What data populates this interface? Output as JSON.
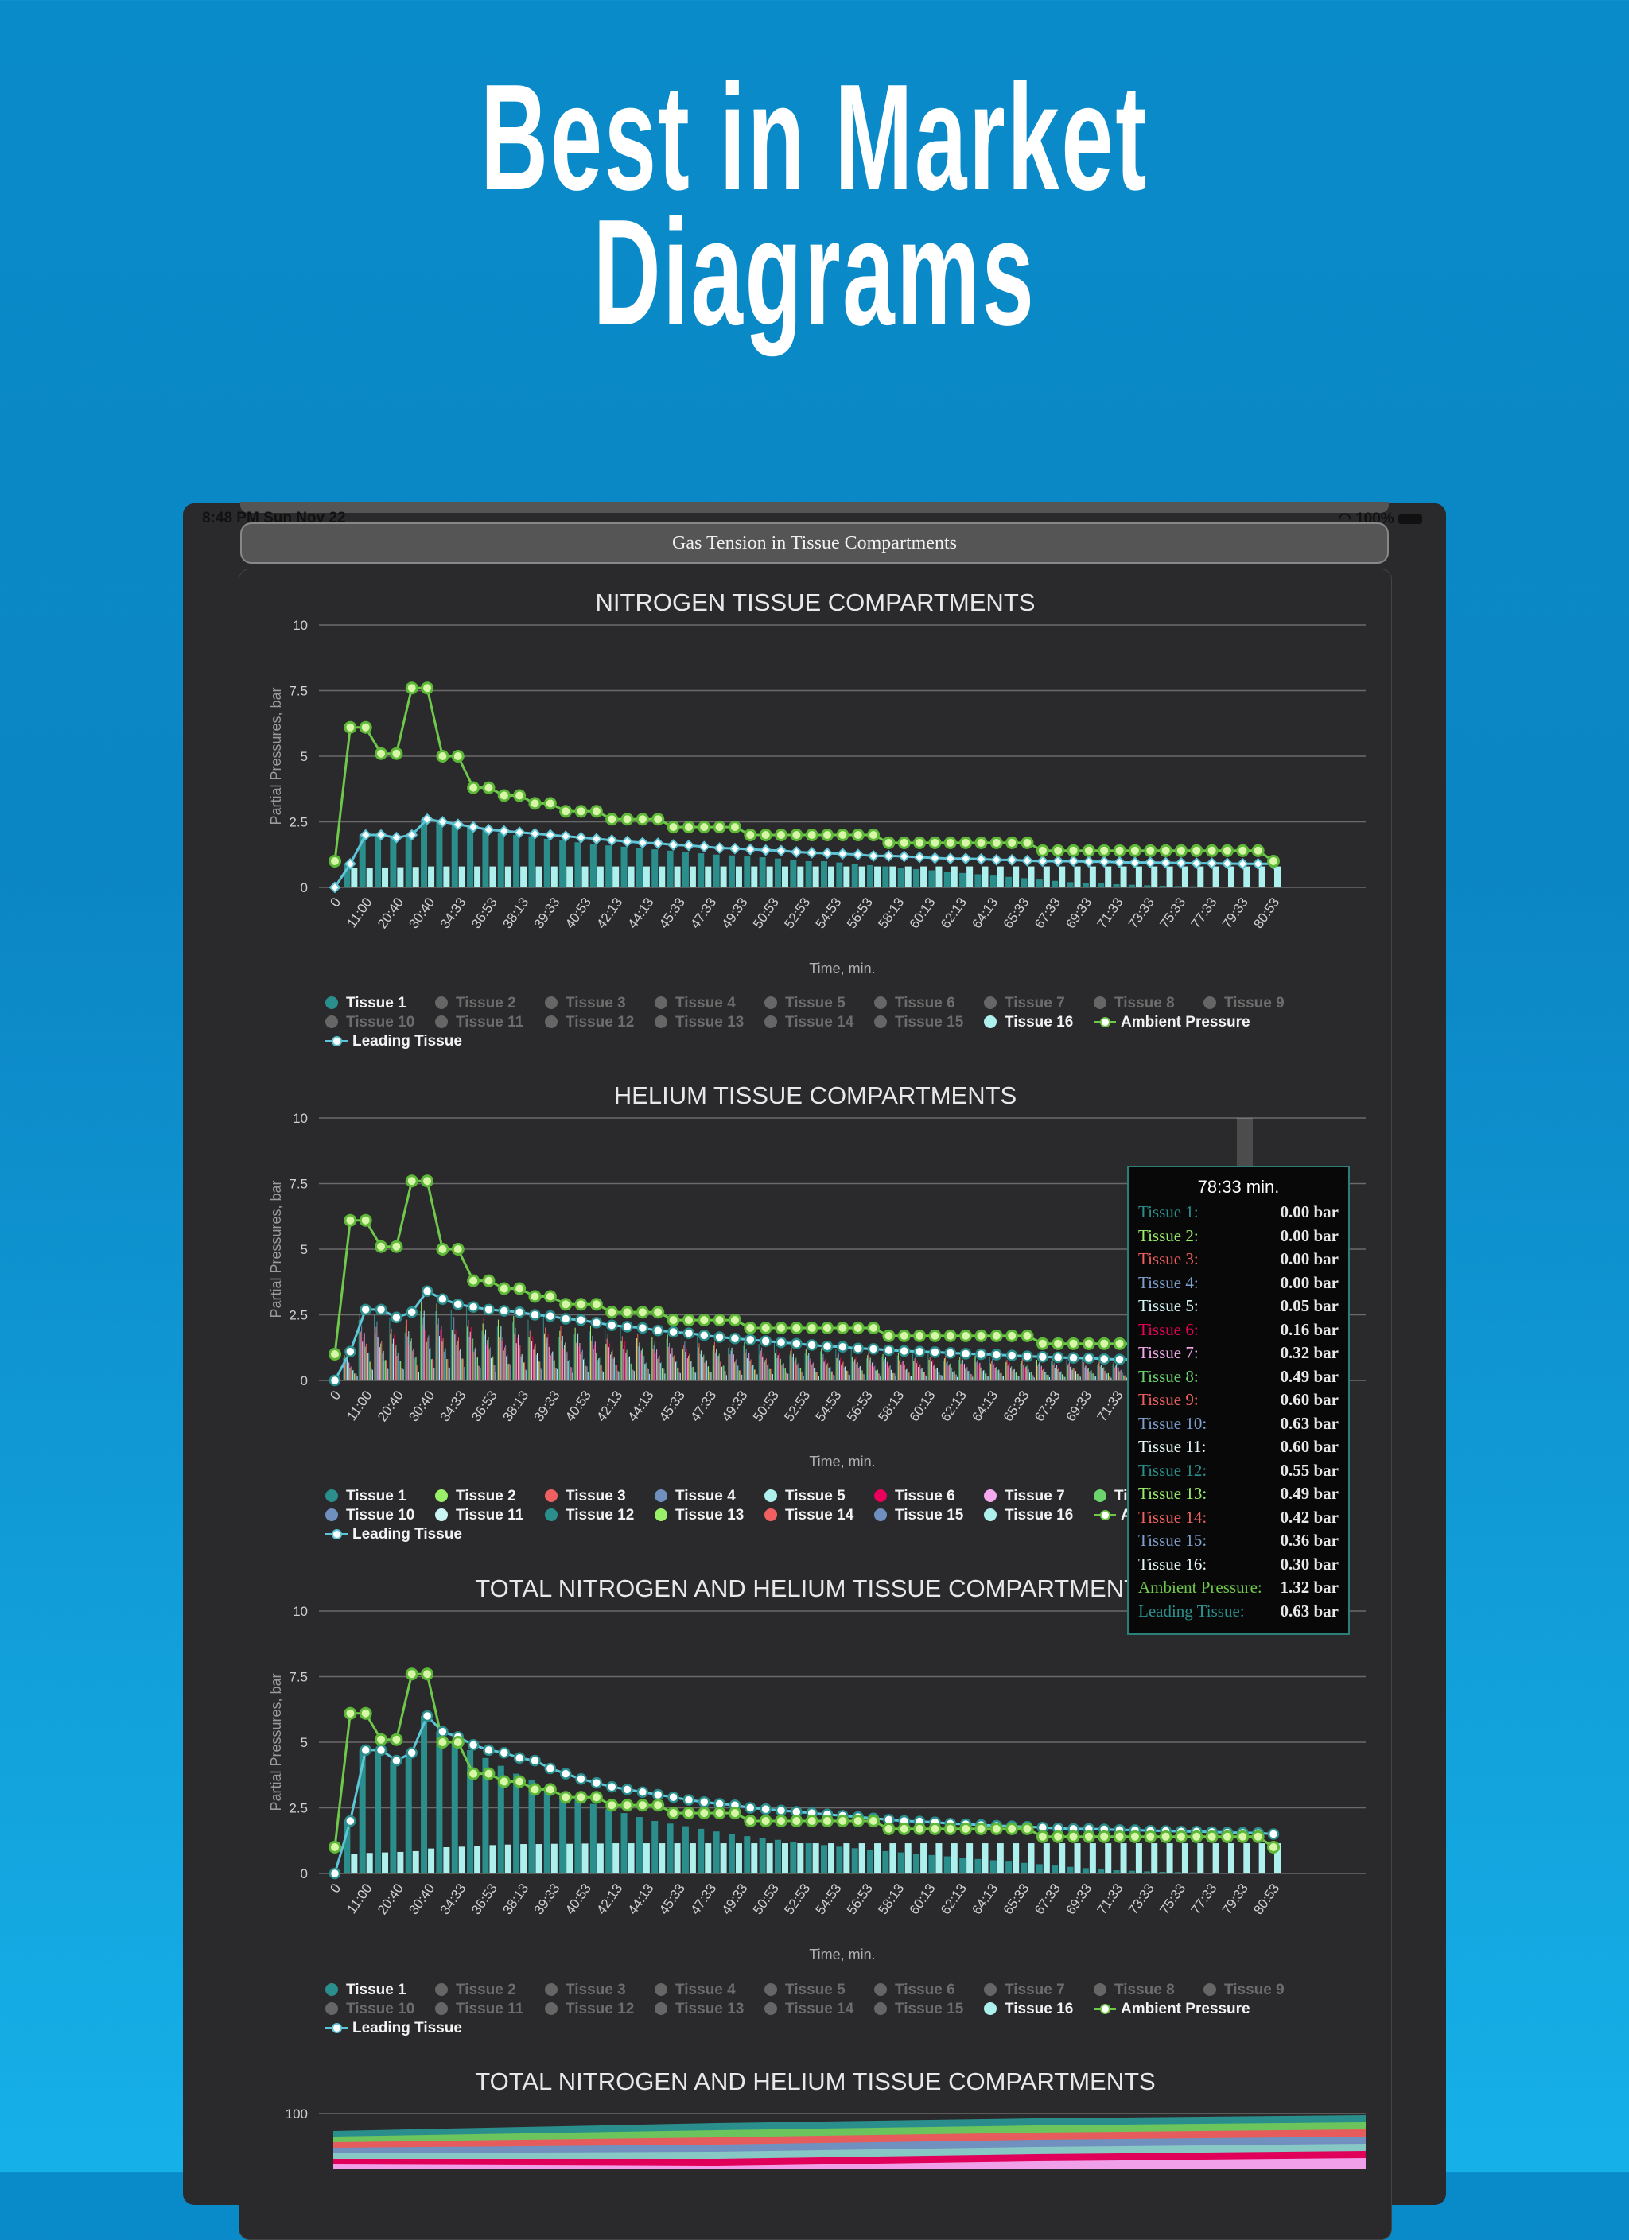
{
  "hero": {
    "line1": "Best in Market",
    "line2": "Diagrams"
  },
  "status": {
    "time": "8:48 PM   Sun Nov 22",
    "battery": "100%"
  },
  "titlebar": {
    "title": "Gas Tension in Tissue Compartments"
  },
  "colors": {
    "teal": "#2a8f8c",
    "cyan": "#aef0ee",
    "green": "#6ccc44",
    "amb_line": "#6fc84a",
    "lead_line": "#5ec5d6",
    "tissue": [
      "#2a8f8c",
      "#9bf06a",
      "#f06060",
      "#6f8fbf",
      "#aef0ee",
      "#e8005a",
      "#f4a8ee",
      "#6cd46c",
      "#f06060",
      "#6f8fbf",
      "#c9f5f5",
      "#2a8f8c",
      "#9bf06a",
      "#f06060",
      "#6f8fbf",
      "#aef0ee"
    ]
  },
  "charts": [
    {
      "title": "NITROGEN TISSUE COMPARTMENTS",
      "xlabel": "Time, min.",
      "ylabel": "Partial Pressures, bar",
      "legend_on": [
        "Tissue 1",
        "Tissue 16",
        "Ambient Pressure",
        "Leading Tissue"
      ],
      "lead_style": "diamond"
    },
    {
      "title": "HELIUM TISSUE COMPARTMENTS",
      "xlabel": "Time, min.",
      "ylabel": "Partial Pressures, bar",
      "legend_on": [
        "Tissue 1",
        "Tissue 2",
        "Tissue 3",
        "Tissue 4",
        "Tissue 5",
        "Tissue 6",
        "Tissue 7",
        "Tissue 8",
        "Tissue 9",
        "Tissue 10",
        "Tissue 11",
        "Tissue 12",
        "Tissue 13",
        "Tissue 14",
        "Tissue 15",
        "Tissue 16",
        "Ambient Pressure",
        "Leading Tissue"
      ],
      "lead_style": "circle"
    },
    {
      "title": "TOTAL NITROGEN AND HELIUM TISSUE COMPARTMENTS",
      "xlabel": "Time, min.",
      "ylabel": "Partial Pressures, bar",
      "legend_on": [
        "Tissue 1",
        "Tissue 16",
        "Ambient Pressure",
        "Leading Tissue"
      ],
      "lead_style": "circle"
    },
    {
      "title": "TOTAL NITROGEN AND HELIUM TISSUE COMPARTMENTS",
      "ytick_top": "100"
    }
  ],
  "legend_labels": {
    "row1": [
      "Tissue 1",
      "Tissue 2",
      "Tissue 3",
      "Tissue 4",
      "Tissue 5",
      "Tissue 6",
      "Tissue 7",
      "Tissue 8",
      "Tissue 9"
    ],
    "row2": [
      "Tissue 10",
      "Tissue 11",
      "Tissue 12",
      "Tissue 13",
      "Tissue 14",
      "Tissue 15",
      "Tissue 16",
      "Ambient Pressure"
    ],
    "row3": [
      "Leading Tissue"
    ]
  },
  "tooltip": {
    "title": "78:33 min.",
    "rows": [
      {
        "name": "Tissue 1:",
        "value": "0.00 bar",
        "color": "#2a8f8c"
      },
      {
        "name": "Tissue 2:",
        "value": "0.00 bar",
        "color": "#9bf06a"
      },
      {
        "name": "Tissue 3:",
        "value": "0.00 bar",
        "color": "#f06060"
      },
      {
        "name": "Tissue 4:",
        "value": "0.00 bar",
        "color": "#7f9fcf"
      },
      {
        "name": "Tissue 5:",
        "value": "0.05 bar",
        "color": "#d4f6f6"
      },
      {
        "name": "Tissue 6:",
        "value": "0.16 bar",
        "color": "#e8005a"
      },
      {
        "name": "Tissue 7:",
        "value": "0.32 bar",
        "color": "#f4a8ee"
      },
      {
        "name": "Tissue 8:",
        "value": "0.49 bar",
        "color": "#6cd46c"
      },
      {
        "name": "Tissue 9:",
        "value": "0.60 bar",
        "color": "#f06060"
      },
      {
        "name": "Tissue 10:",
        "value": "0.63 bar",
        "color": "#7f9fcf"
      },
      {
        "name": "Tissue 11:",
        "value": "0.60 bar",
        "color": "#e6f8f8"
      },
      {
        "name": "Tissue 12:",
        "value": "0.55 bar",
        "color": "#2a8f8c"
      },
      {
        "name": "Tissue 13:",
        "value": "0.49 bar",
        "color": "#9bf06a"
      },
      {
        "name": "Tissue 14:",
        "value": "0.42 bar",
        "color": "#f06060"
      },
      {
        "name": "Tissue 15:",
        "value": "0.36 bar",
        "color": "#7f9fcf"
      },
      {
        "name": "Tissue 16:",
        "value": "0.30 bar",
        "color": "#e6f8f8"
      },
      {
        "name": "Ambient Pressure:",
        "value": "1.32 bar",
        "color": "#6fc84a"
      },
      {
        "name": "Leading Tissue:",
        "value": "0.63 bar",
        "color": "#2a8f8c"
      }
    ]
  },
  "chart_data": [
    {
      "type": "line",
      "title": "NITROGEN TISSUE COMPARTMENTS",
      "xlabel": "Time, min.",
      "ylabel": "Partial Pressures, bar",
      "ylim": [
        0,
        10
      ],
      "yticks": [
        "0",
        "2.5",
        "5",
        "7.5",
        "10"
      ],
      "x_tick_labels": [
        "0",
        "11:00",
        "20:40",
        "30:40",
        "34:33",
        "36:53",
        "38:13",
        "39:33",
        "40:53",
        "42:13",
        "44:13",
        "45:33",
        "47:33",
        "49:33",
        "50:53",
        "52:53",
        "54:53",
        "56:53",
        "58:13",
        "60:13",
        "62:13",
        "64:13",
        "65:33",
        "67:33",
        "69:33",
        "71:33",
        "73:33",
        "75:33",
        "77:33",
        "79:33",
        "80:53"
      ],
      "series": [
        {
          "name": "Ambient Pressure",
          "values": [
            1.0,
            6.1,
            6.1,
            5.1,
            5.1,
            7.6,
            7.6,
            5.0,
            5.0,
            3.8,
            3.8,
            3.5,
            3.5,
            3.2,
            3.2,
            2.9,
            2.9,
            2.9,
            2.6,
            2.6,
            2.6,
            2.6,
            2.3,
            2.3,
            2.3,
            2.3,
            2.3,
            2.0,
            2.0,
            2.0,
            2.0,
            2.0,
            2.0,
            2.0,
            2.0,
            2.0,
            1.7,
            1.7,
            1.7,
            1.7,
            1.7,
            1.7,
            1.7,
            1.7,
            1.7,
            1.7,
            1.4,
            1.4,
            1.4,
            1.4,
            1.4,
            1.4,
            1.4,
            1.4,
            1.4,
            1.4,
            1.4,
            1.4,
            1.4,
            1.4,
            1.4,
            1.0
          ]
        },
        {
          "name": "Leading Tissue",
          "values": [
            0,
            0.9,
            2.0,
            2.0,
            1.9,
            2.0,
            2.6,
            2.5,
            2.4,
            2.3,
            2.2,
            2.15,
            2.1,
            2.05,
            2.0,
            1.95,
            1.9,
            1.85,
            1.8,
            1.75,
            1.7,
            1.68,
            1.62,
            1.6,
            1.55,
            1.5,
            1.48,
            1.45,
            1.42,
            1.4,
            1.35,
            1.32,
            1.3,
            1.28,
            1.25,
            1.2,
            1.2,
            1.18,
            1.15,
            1.12,
            1.1,
            1.1,
            1.08,
            1.05,
            1.05,
            1.02,
            1.0,
            1.0,
            1.0,
            0.98,
            0.98,
            0.96,
            0.95,
            0.95,
            0.94,
            0.93,
            0.92,
            0.92,
            0.91,
            0.9,
            0.9,
            0.9
          ]
        },
        {
          "name": "Tissue 1",
          "values": [
            0,
            0.9,
            2.0,
            2.0,
            1.9,
            2.0,
            2.6,
            2.5,
            2.4,
            2.3,
            2.2,
            2.1,
            2.0,
            1.95,
            1.85,
            1.8,
            1.72,
            1.65,
            1.6,
            1.55,
            1.5,
            1.45,
            1.4,
            1.35,
            1.3,
            1.25,
            1.22,
            1.18,
            1.15,
            1.1,
            1.05,
            1.0,
            1.0,
            0.95,
            0.9,
            0.85,
            0.8,
            0.75,
            0.7,
            0.65,
            0.6,
            0.55,
            0.5,
            0.45,
            0.4,
            0.35,
            0.3,
            0.25,
            0.2,
            0.18,
            0.15,
            0.12,
            0.1,
            0.08,
            0.06,
            0.05,
            0.04,
            0.03,
            0.02,
            0.01,
            0.01,
            0
          ]
        },
        {
          "name": "Tissue 16",
          "values": [
            0,
            0.75,
            0.75,
            0.76,
            0.77,
            0.78,
            0.8,
            0.8,
            0.8,
            0.8,
            0.8,
            0.8,
            0.8,
            0.8,
            0.8,
            0.8,
            0.8,
            0.8,
            0.8,
            0.8,
            0.8,
            0.8,
            0.8,
            0.8,
            0.8,
            0.8,
            0.8,
            0.8,
            0.8,
            0.8,
            0.8,
            0.8,
            0.8,
            0.8,
            0.8,
            0.8,
            0.8,
            0.8,
            0.8,
            0.8,
            0.8,
            0.8,
            0.8,
            0.8,
            0.8,
            0.8,
            0.8,
            0.8,
            0.8,
            0.8,
            0.8,
            0.8,
            0.8,
            0.8,
            0.8,
            0.8,
            0.8,
            0.8,
            0.8,
            0.8,
            0.8,
            0.8
          ]
        }
      ]
    },
    {
      "type": "line",
      "title": "HELIUM TISSUE COMPARTMENTS",
      "xlabel": "Time, min.",
      "ylabel": "Partial Pressures, bar",
      "ylim": [
        0,
        10
      ],
      "yticks": [
        "0",
        "2.5",
        "5",
        "7.5",
        "10"
      ],
      "x_tick_labels": [
        "0",
        "11:00",
        "20:40",
        "30:40",
        "34:33",
        "36:53",
        "38:13",
        "39:33",
        "40:53",
        "42:13",
        "44:13",
        "45:33",
        "47:33",
        "49:33",
        "50:53",
        "52:53",
        "54:53",
        "56:53",
        "58:13",
        "60:13",
        "62:13",
        "64:13",
        "65:33",
        "67:33",
        "69:33",
        "71:33",
        "73:33",
        "75:33",
        "77:33",
        "79:33",
        "80:53"
      ],
      "series": [
        {
          "name": "Ambient Pressure",
          "values": [
            1.0,
            6.1,
            6.1,
            5.1,
            5.1,
            7.6,
            7.6,
            5.0,
            5.0,
            3.8,
            3.8,
            3.5,
            3.5,
            3.2,
            3.2,
            2.9,
            2.9,
            2.9,
            2.6,
            2.6,
            2.6,
            2.6,
            2.3,
            2.3,
            2.3,
            2.3,
            2.3,
            2.0,
            2.0,
            2.0,
            2.0,
            2.0,
            2.0,
            2.0,
            2.0,
            2.0,
            1.7,
            1.7,
            1.7,
            1.7,
            1.7,
            1.7,
            1.7,
            1.7,
            1.7,
            1.7,
            1.4,
            1.4,
            1.4,
            1.4,
            1.4,
            1.4,
            1.4,
            1.4,
            1.4,
            1.4,
            1.4,
            1.4,
            1.4,
            1.4,
            1.4,
            1.0
          ]
        },
        {
          "name": "Leading Tissue",
          "values": [
            0,
            1.1,
            2.7,
            2.7,
            2.4,
            2.6,
            3.4,
            3.1,
            2.9,
            2.8,
            2.7,
            2.65,
            2.6,
            2.5,
            2.45,
            2.35,
            2.3,
            2.2,
            2.1,
            2.05,
            2.0,
            1.9,
            1.85,
            1.8,
            1.72,
            1.65,
            1.6,
            1.55,
            1.5,
            1.45,
            1.4,
            1.35,
            1.3,
            1.28,
            1.22,
            1.2,
            1.15,
            1.12,
            1.1,
            1.08,
            1.05,
            1.02,
            1.0,
            0.98,
            0.95,
            0.92,
            0.9,
            0.88,
            0.86,
            0.85,
            0.82,
            0.8,
            0.8,
            0.78,
            0.76,
            0.75,
            0.72,
            0.7,
            0.68,
            0.66,
            0.64,
            0.63
          ]
        },
        {
          "name": "Tissue 1",
          "values": [
            0,
            1.1,
            2.7,
            2.7,
            2.4,
            2.6,
            3.4,
            3.1,
            2.9,
            2.8,
            2.7,
            2.65,
            2.6,
            2.5,
            2.45,
            2.35,
            2.3,
            2.2,
            2.1,
            2.05,
            2.0,
            1.9,
            1.85,
            1.8,
            1.72,
            1.65,
            1.6,
            1.55,
            1.5,
            1.45,
            1.4,
            1.35,
            1.3,
            1.28,
            1.22,
            1.2,
            1.15,
            1.12,
            1.1,
            1.08,
            1.05,
            1.02,
            1.0,
            0.98,
            0.95,
            0.92,
            0.9,
            0.88,
            0.86,
            0.85,
            0.82,
            0.8,
            0.8,
            0.78,
            0.76,
            0.75,
            0.72,
            0.7,
            0.68,
            0.66,
            0.64,
            0.63
          ]
        }
      ]
    },
    {
      "type": "line",
      "title": "TOTAL NITROGEN AND HELIUM TISSUE COMPARTMENTS",
      "xlabel": "Time, min.",
      "ylabel": "Partial Pressures, bar",
      "ylim": [
        0,
        10
      ],
      "yticks": [
        "0",
        "2.5",
        "5",
        "7.5",
        "10"
      ],
      "x_tick_labels": [
        "0",
        "11:00",
        "20:40",
        "30:40",
        "34:33",
        "36:53",
        "38:13",
        "39:33",
        "40:53",
        "42:13",
        "44:13",
        "45:33",
        "47:33",
        "49:33",
        "50:53",
        "52:53",
        "54:53",
        "56:53",
        "58:13",
        "60:13",
        "62:13",
        "64:13",
        "65:33",
        "67:33",
        "69:33",
        "71:33",
        "73:33",
        "75:33",
        "77:33",
        "79:33",
        "80:53"
      ],
      "series": [
        {
          "name": "Ambient Pressure",
          "values": [
            1.0,
            6.1,
            6.1,
            5.1,
            5.1,
            7.6,
            7.6,
            5.0,
            5.0,
            3.8,
            3.8,
            3.5,
            3.5,
            3.2,
            3.2,
            2.9,
            2.9,
            2.9,
            2.6,
            2.6,
            2.6,
            2.6,
            2.3,
            2.3,
            2.3,
            2.3,
            2.3,
            2.0,
            2.0,
            2.0,
            2.0,
            2.0,
            2.0,
            2.0,
            2.0,
            2.0,
            1.7,
            1.7,
            1.7,
            1.7,
            1.7,
            1.7,
            1.7,
            1.7,
            1.7,
            1.7,
            1.4,
            1.4,
            1.4,
            1.4,
            1.4,
            1.4,
            1.4,
            1.4,
            1.4,
            1.4,
            1.4,
            1.4,
            1.4,
            1.4,
            1.4,
            1.0
          ]
        },
        {
          "name": "Leading Tissue",
          "values": [
            0,
            2.0,
            4.7,
            4.7,
            4.3,
            4.6,
            6.0,
            5.4,
            5.2,
            4.9,
            4.7,
            4.6,
            4.4,
            4.3,
            4.0,
            3.8,
            3.6,
            3.45,
            3.3,
            3.2,
            3.1,
            3.0,
            2.9,
            2.8,
            2.72,
            2.65,
            2.6,
            2.5,
            2.45,
            2.4,
            2.35,
            2.3,
            2.25,
            2.2,
            2.15,
            2.1,
            2.05,
            2.0,
            1.98,
            1.95,
            1.9,
            1.88,
            1.85,
            1.82,
            1.8,
            1.78,
            1.75,
            1.72,
            1.7,
            1.7,
            1.68,
            1.66,
            1.65,
            1.63,
            1.62,
            1.6,
            1.6,
            1.58,
            1.56,
            1.55,
            1.54,
            1.5
          ]
        },
        {
          "name": "Tissue 1",
          "values": [
            0,
            2.0,
            4.7,
            4.7,
            4.3,
            4.6,
            6.0,
            5.4,
            5.0,
            4.7,
            4.4,
            4.1,
            3.8,
            3.55,
            3.3,
            3.05,
            2.85,
            2.65,
            2.45,
            2.3,
            2.15,
            2.0,
            1.9,
            1.8,
            1.7,
            1.6,
            1.5,
            1.42,
            1.35,
            1.28,
            1.2,
            1.15,
            1.08,
            1.02,
            0.96,
            0.9,
            0.85,
            0.8,
            0.75,
            0.7,
            0.65,
            0.6,
            0.55,
            0.5,
            0.45,
            0.4,
            0.35,
            0.3,
            0.25,
            0.2,
            0.15,
            0.12,
            0.1,
            0.08,
            0.06,
            0.05,
            0.04,
            0.03,
            0.02,
            0.01,
            0.01,
            0
          ]
        },
        {
          "name": "Tissue 16",
          "values": [
            0,
            0.75,
            0.78,
            0.8,
            0.82,
            0.85,
            0.95,
            1.0,
            1.02,
            1.05,
            1.08,
            1.1,
            1.12,
            1.12,
            1.13,
            1.13,
            1.14,
            1.14,
            1.15,
            1.15,
            1.15,
            1.15,
            1.15,
            1.15,
            1.15,
            1.15,
            1.15,
            1.15,
            1.15,
            1.15,
            1.15,
            1.15,
            1.15,
            1.15,
            1.15,
            1.15,
            1.15,
            1.15,
            1.15,
            1.15,
            1.15,
            1.15,
            1.15,
            1.15,
            1.15,
            1.15,
            1.15,
            1.15,
            1.15,
            1.15,
            1.15,
            1.15,
            1.15,
            1.15,
            1.15,
            1.15,
            1.15,
            1.15,
            1.15,
            1.15,
            1.15,
            1.15
          ]
        }
      ]
    },
    {
      "type": "area",
      "title": "TOTAL NITROGEN AND HELIUM TISSUE COMPARTMENTS",
      "yticks": [
        "100"
      ]
    }
  ]
}
